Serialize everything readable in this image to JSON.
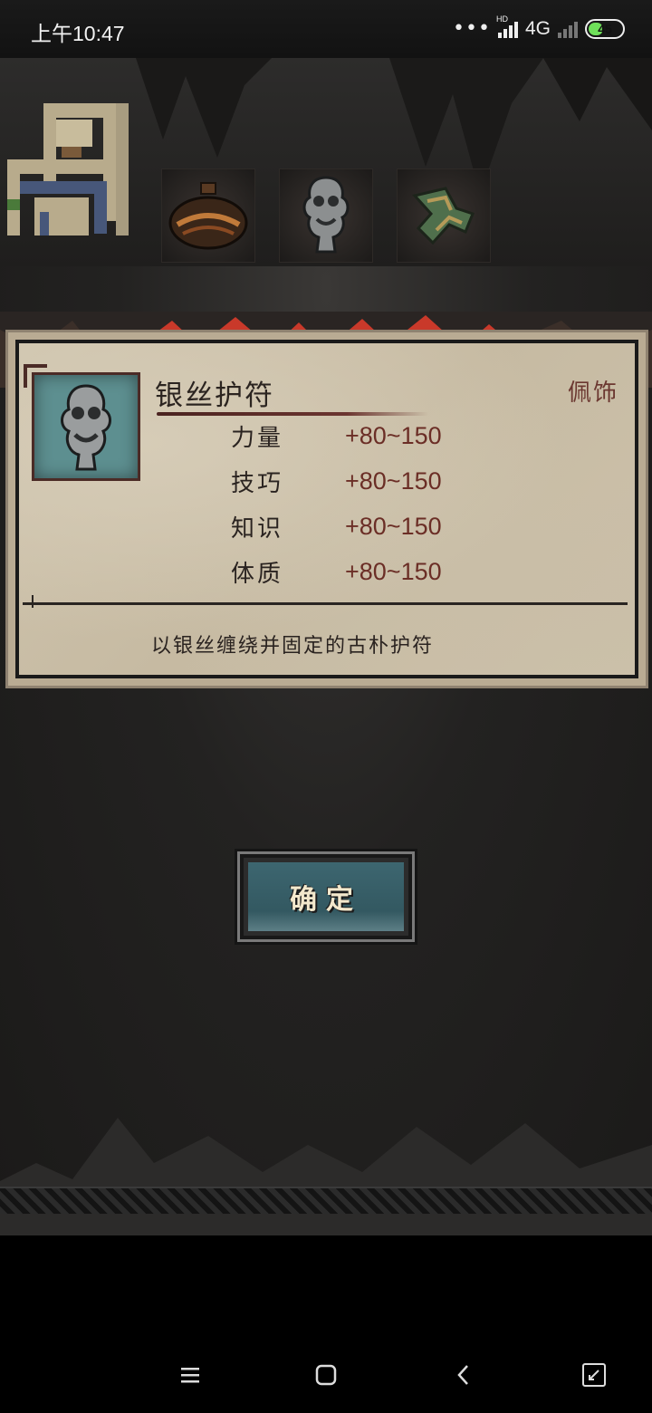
{
  "status_bar": {
    "time": "上午10:47",
    "network_label": "4G",
    "hd_label": "HD",
    "battery_level": "45",
    "battery_color": "#6fe05a"
  },
  "minimap": {
    "icon": "minimap-icon"
  },
  "item_slots": [
    {
      "icon": "pottery-jar-icon"
    },
    {
      "icon": "silver-amulet-icon"
    },
    {
      "icon": "jade-ornament-icon"
    }
  ],
  "item_panel": {
    "title": "银丝护符",
    "type": "佩饰",
    "icon": "silver-amulet-icon",
    "stats": [
      {
        "name": "力量",
        "value": "+80~150"
      },
      {
        "name": "技巧",
        "value": "+80~150"
      },
      {
        "name": "知识",
        "value": "+80~150"
      },
      {
        "name": "体质",
        "value": "+80~150"
      }
    ],
    "description": "以银丝缠绕并固定的古朴护符"
  },
  "confirm_button": {
    "label": "确定"
  },
  "nav_bar": {
    "menu": "menu-icon",
    "home": "home-icon",
    "back": "back-icon",
    "recents": "recents-icon"
  },
  "colors": {
    "accent_red": "#c9392a",
    "parchment": "#cfc4ad",
    "button_teal": "#3d6670"
  }
}
